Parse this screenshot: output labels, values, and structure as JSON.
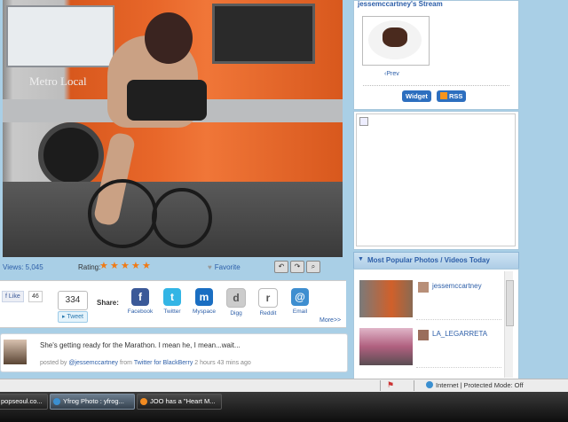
{
  "stream": {
    "title": "jessemccartney's Stream",
    "prev_label": "Prev",
    "widget_label": "Widget",
    "rss_label": "RSS"
  },
  "stats": {
    "views": "Views: 5,045",
    "rating_label": "Rating:",
    "rating_stars": 5,
    "favorite_label": "Favorite"
  },
  "share": {
    "fb_like": "Like",
    "fb_count": "46",
    "tweet_count": "334",
    "tweet_label": "Tweet",
    "share_label": "Share:",
    "items": [
      {
        "label": "Facebook",
        "glyph": "f",
        "color": "#3b5998"
      },
      {
        "label": "Twitter",
        "glyph": "t",
        "color": "#33b5e5"
      },
      {
        "label": "Myspace",
        "glyph": "m",
        "color": "#1a6ec2"
      },
      {
        "label": "Digg",
        "glyph": "d",
        "color": "#cccccc"
      },
      {
        "label": "Reddit",
        "glyph": "r",
        "color": "#ffffff"
      },
      {
        "label": "Email",
        "glyph": "@",
        "color": "#3e8ed0"
      }
    ],
    "more_label": "More>>"
  },
  "comment": {
    "text": "She's getting ready for the Marathon. I mean he, I mean...wait...",
    "posted_by": "posted by",
    "user": "@jessemccartney",
    "from": "from",
    "client": "Twitter for BlackBerry",
    "time": "2 hours 43 mins ago"
  },
  "popular": {
    "title": "Most Popular Photos / Videos Today",
    "items": [
      {
        "user": "jessemccartney"
      },
      {
        "user": "LA_LEGARRETA"
      }
    ]
  },
  "photo": {
    "bus_text": "Metro Local"
  },
  "statusbar": {
    "zone": "Internet | Protected Mode: Off"
  },
  "taskbar": {
    "tasks": [
      {
        "label": "popseoul.co..."
      },
      {
        "label": "Yfrog Photo : yfrog..."
      },
      {
        "label": "JOO has a \"Heart M..."
      }
    ]
  }
}
